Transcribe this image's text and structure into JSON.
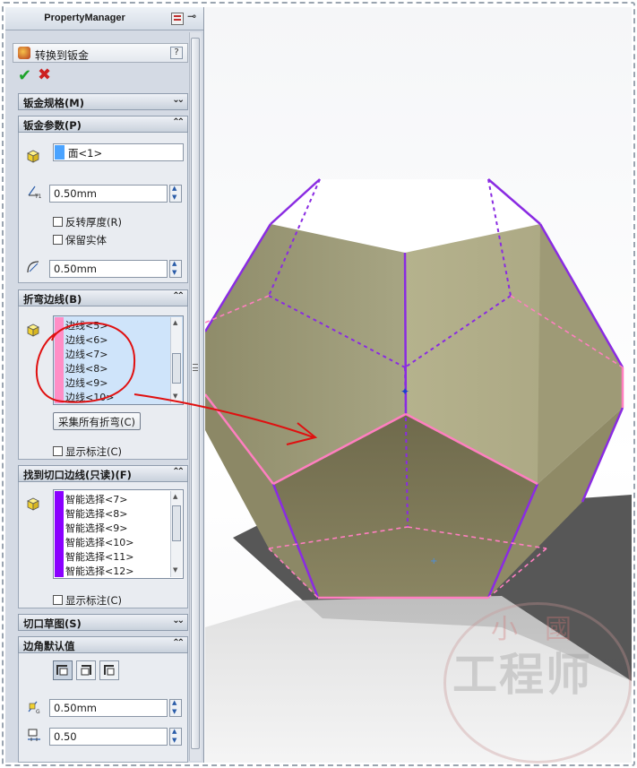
{
  "property_manager": {
    "title": "PropertyManager",
    "feature_title": "转换到钣金",
    "help": "?",
    "ok": "✔",
    "cancel": "✖"
  },
  "groups": {
    "sheet_gauge": {
      "label": "钣金规格(M)",
      "chevron": "»"
    },
    "sheet_params": {
      "label": "钣金参数(P)",
      "chevron": "«",
      "face_value": "面<1>",
      "thickness": "0.50mm",
      "reverse_thickness_label": "反转厚度(R)",
      "keep_body_label": "保留实体",
      "radius": "0.50mm"
    },
    "bend_edges": {
      "label": "折弯边线(B)",
      "chevron": "«",
      "items": [
        "边线<5>",
        "边线<6>",
        "边线<7>",
        "边线<8>",
        "边线<9>",
        "边线<10>"
      ],
      "collect_button": "采集所有折弯(C)",
      "show_callouts_label": "显示标注(C)",
      "list_color": "#ff8ec6"
    },
    "rip_edges": {
      "label": "找到切口边线(只读)(F)",
      "chevron": "«",
      "items": [
        "智能选择<7>",
        "智能选择<8>",
        "智能选择<9>",
        "智能选择<10>",
        "智能选择<11>",
        "智能选择<12>"
      ],
      "show_callouts_label": "显示标注(C)",
      "list_color": "#8a00ff"
    },
    "rip_sketch": {
      "label": "切口草图(S)",
      "chevron": "»"
    },
    "corner_defaults": {
      "label": "边角默认值",
      "chevron": "«",
      "gap": "0.50mm",
      "ratio": "0.50"
    }
  },
  "colors": {
    "panel_bg": "#d4dae4",
    "face_selection": "#4aa3ff",
    "bend_edge": "#ff7fc0",
    "rip_edge": "#8a2be2",
    "annotation_red": "#e01010"
  },
  "watermark": {
    "text": "工程师",
    "small_text": "小國"
  }
}
